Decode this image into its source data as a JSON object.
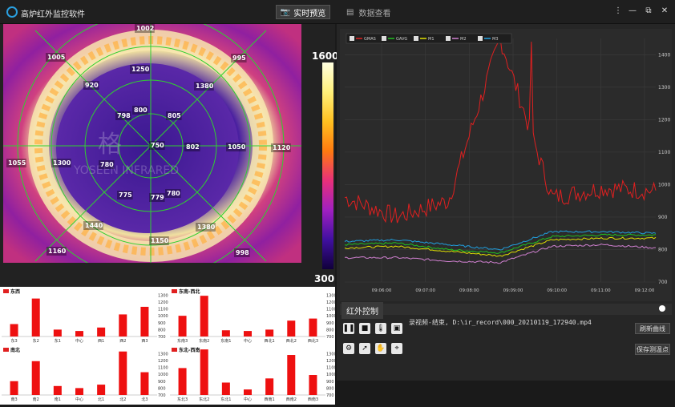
{
  "app": {
    "title": "高炉红外监控软件"
  },
  "header": {
    "live_label": "实时预览",
    "data_label": "数据查看",
    "more": "⋮",
    "min": "—",
    "restore": "⧉",
    "close": "✕"
  },
  "thermal": {
    "watermark": "YOSEEN INFRARED",
    "labels": [
      {
        "t": "1002"
      },
      {
        "t": "1005"
      },
      {
        "t": "995"
      },
      {
        "t": "1250"
      },
      {
        "t": "920"
      },
      {
        "t": "1380"
      },
      {
        "t": "800"
      },
      {
        "t": "798"
      },
      {
        "t": "805"
      },
      {
        "t": "750"
      },
      {
        "t": "802"
      },
      {
        "t": "1050"
      },
      {
        "t": "1120"
      },
      {
        "t": "1055"
      },
      {
        "t": "1300"
      },
      {
        "t": "780"
      },
      {
        "t": "775"
      },
      {
        "t": "779"
      },
      {
        "t": "780"
      },
      {
        "t": "1440"
      },
      {
        "t": "1380"
      },
      {
        "t": "1160"
      },
      {
        "t": "1150"
      },
      {
        "t": "998"
      }
    ]
  },
  "colorbar": {
    "max": "1600",
    "min": "300"
  },
  "bar_panels": [
    {
      "title": "东西",
      "categories": [
        "东3",
        "东2",
        "东1",
        "中心",
        "西1",
        "西2",
        "西3"
      ],
      "values": [
        880,
        1250,
        800,
        780,
        830,
        1020,
        1130
      ]
    },
    {
      "title": "东南-西北",
      "categories": [
        "东南3",
        "东南2",
        "东南1",
        "中心",
        "西北1",
        "西北2",
        "西北3"
      ],
      "values": [
        1000,
        1290,
        790,
        780,
        800,
        930,
        960
      ]
    },
    {
      "title": "南北",
      "categories": [
        "南3",
        "南2",
        "南1",
        "中心",
        "北1",
        "北2",
        "北3"
      ],
      "values": [
        900,
        1190,
        830,
        800,
        850,
        1330,
        1030
      ]
    },
    {
      "title": "东北-西南",
      "categories": [
        "东北3",
        "东北2",
        "东北1",
        "中心",
        "西南1",
        "西南2",
        "西南3"
      ],
      "values": [
        1090,
        1360,
        880,
        780,
        940,
        1280,
        990
      ]
    }
  ],
  "bar_axis": {
    "ticks": [
      "1300",
      "1200",
      "1100",
      "1000",
      "900",
      "800",
      "700"
    ]
  },
  "chart_data": {
    "type": "line",
    "x": [
      "09:06:00",
      "09:07:00",
      "09:08:00",
      "09:09:00",
      "09:10:00",
      "09:11:00",
      "09:12:00"
    ],
    "ylim": [
      700,
      1450
    ],
    "yticks": [
      "1400",
      "1300",
      "1200",
      "1100",
      "1000",
      "900",
      "800",
      "700"
    ],
    "legend_placement": "top-left",
    "series": [
      {
        "name": "GMAS",
        "color": "#e02020",
        "values": [
          960,
          900,
          950,
          1450,
          960,
          990,
          980
        ]
      },
      {
        "name": "GAVG",
        "color": "#20c020",
        "values": [
          815,
          820,
          800,
          790,
          840,
          845,
          845
        ]
      },
      {
        "name": "M1",
        "color": "#e0e000",
        "values": [
          805,
          810,
          795,
          780,
          830,
          835,
          835
        ]
      },
      {
        "name": "M2",
        "color": "#d080d0",
        "values": [
          775,
          775,
          765,
          760,
          810,
          815,
          805
        ]
      },
      {
        "name": "M3",
        "color": "#20a0e0",
        "values": [
          825,
          830,
          815,
          800,
          855,
          855,
          850
        ]
      }
    ]
  },
  "ir_control": {
    "label": "红外控制",
    "status": "录视频-结束, D:\\ir_record\\000_20210119_172940.mp4",
    "refresh": "刷新曲线",
    "save": "保存测温点"
  }
}
